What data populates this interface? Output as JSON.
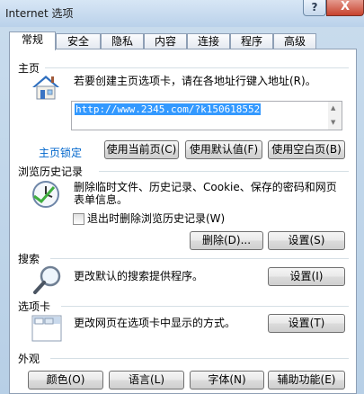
{
  "window": {
    "title": "Internet 选项",
    "help_label": "?",
    "close_label": "X"
  },
  "tabs": [
    "常规",
    "安全",
    "隐私",
    "内容",
    "连接",
    "程序",
    "高级"
  ],
  "homepage": {
    "group_label": "主页",
    "description": "若要创建主页选项卡，请在各地址行键入地址(R)。",
    "url": "http://www.2345.com/?k150618552",
    "lock_link": "主页锁定",
    "use_current": "使用当前页(C)",
    "use_default": "使用默认值(F)",
    "use_blank": "使用空白页(B)"
  },
  "history": {
    "group_label": "浏览历史记录",
    "description_line1": "删除临时文件、历史记录、Cookie、保存的密码和网页",
    "description_line2": "表单信息。",
    "delete_on_exit": "退出时删除浏览历史记录(W)",
    "delete_button": "删除(D)...",
    "settings_button": "设置(S)"
  },
  "search": {
    "group_label": "搜索",
    "description": "更改默认的搜索提供程序。",
    "settings_button": "设置(I)"
  },
  "tabs_section": {
    "group_label": "选项卡",
    "description": "更改网页在选项卡中显示的方式。",
    "settings_button": "设置(T)"
  },
  "appearance": {
    "group_label": "外观",
    "colors": "颜色(O)",
    "languages": "语言(L)",
    "fonts": "字体(N)",
    "accessibility": "辅助功能(E)"
  }
}
